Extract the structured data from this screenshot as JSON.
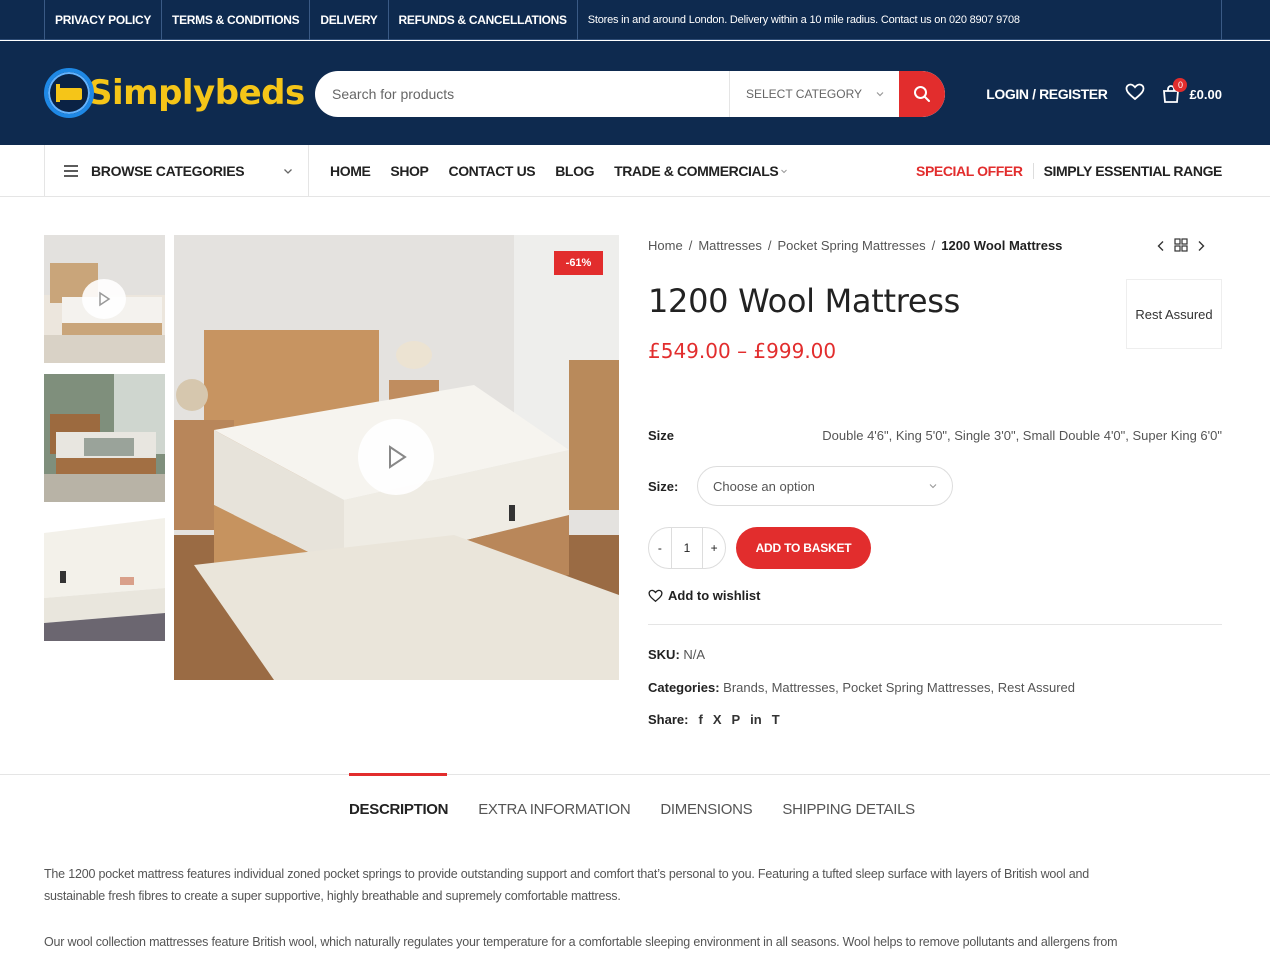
{
  "topbar": {
    "links": [
      "PRIVACY POLICY",
      "TERMS & CONDITIONS",
      "DELIVERY",
      "REFUNDS & CANCELLATIONS"
    ],
    "message": "Stores in and around London. Delivery within a 10 mile radius. Contact us on 020 8907 9708"
  },
  "header": {
    "logo_text": "Simplybeds",
    "search_placeholder": "Search for products",
    "category_label": "SELECT CATEGORY",
    "login_label": "LOGIN / REGISTER",
    "cart_count": "0",
    "cart_total": "£0.00"
  },
  "nav": {
    "browse_label": "BROWSE CATEGORIES",
    "items": [
      "HOME",
      "SHOP",
      "CONTACT US",
      "BLOG",
      "TRADE & COMMERCIALS"
    ],
    "special_offer": "SPECIAL OFFER",
    "essential": "SIMPLY ESSENTIAL RANGE"
  },
  "gallery": {
    "sale_badge": "-61%"
  },
  "breadcrumb": {
    "items": [
      "Home",
      "Mattresses",
      "Pocket Spring Mattresses"
    ],
    "current": "1200 Wool Mattress",
    "separator": "/"
  },
  "product": {
    "title": "1200 Wool Mattress",
    "brand": "Rest Assured",
    "price": "£549.00 – £999.00",
    "attribute_label": "Size",
    "attribute_values": "Double 4'6\", King 5'0\", Single 3'0\", Small Double 4'0\", Super King 6'0\"",
    "size_select_label": "Size:",
    "size_select_placeholder": "Choose an option",
    "quantity_minus": "-",
    "quantity": "1",
    "quantity_plus": "+",
    "add_to_basket": "ADD TO BASKET",
    "add_to_wishlist": "Add to wishlist",
    "sku_label": "SKU:",
    "sku": "N/A",
    "categories_label": "Categories:",
    "categories": "Brands, Mattresses, Pocket Spring Mattresses, Rest Assured",
    "share_label": "Share:",
    "share_icons": [
      "f",
      "X",
      "P",
      "in",
      "T"
    ]
  },
  "tabs": {
    "items": [
      "DESCRIPTION",
      "EXTRA INFORMATION",
      "DIMENSIONS",
      "SHIPPING DETAILS"
    ],
    "active": "DESCRIPTION"
  },
  "description": {
    "p1_line1": "The 1200 pocket mattress features individual zoned pocket springs to provide outstanding support and comfort that’s personal to you. Featuring a tufted sleep surface with layers of British wool and",
    "p1_line2": "sustainable fresh fibres to create a super supportive, highly breathable and supremely comfortable mattress.",
    "p2_line1": "Our wool collection mattresses feature British wool, which naturally regulates your temperature for a comfortable sleeping environment in all seasons. Wool helps to remove pollutants and allergens from"
  },
  "colors": {
    "navy": "#0e2a4f",
    "accent_red": "#e22d2d",
    "logo_yellow": "#f5c518"
  }
}
